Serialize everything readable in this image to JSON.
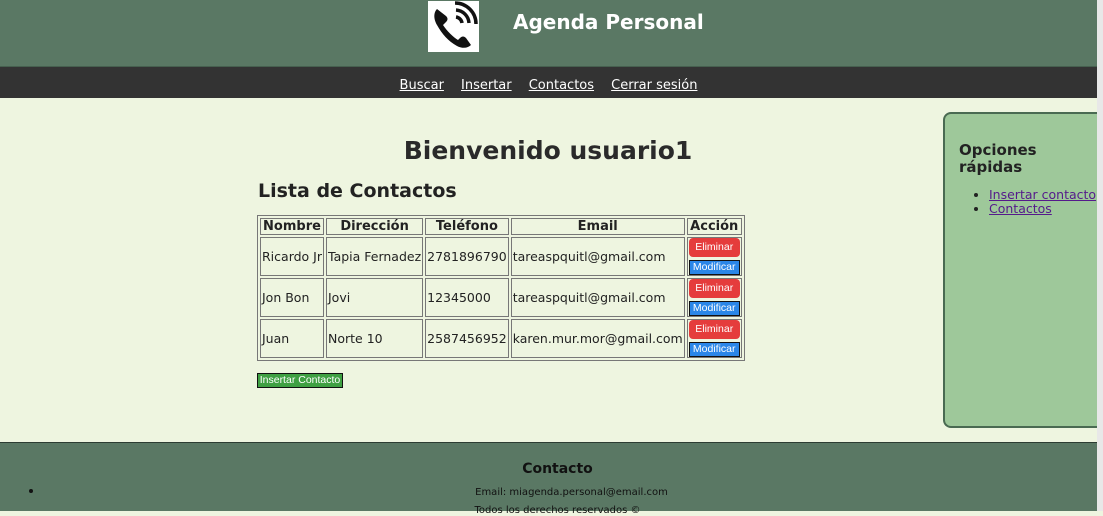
{
  "header": {
    "title": "Agenda Personal",
    "logo_icon": "phone-icon"
  },
  "nav": {
    "items": [
      "Buscar",
      "Insertar",
      "Contactos",
      "Cerrar sesión"
    ]
  },
  "main": {
    "welcome": "Bienvenido usuario1",
    "list_title": "Lista de Contactos",
    "table": {
      "headers": [
        "Nombre",
        "Dirección",
        "Teléfono",
        "Email",
        "Acción"
      ],
      "rows": [
        [
          "Ricardo Jr",
          "Tapia Fernadez",
          "2781896790",
          "tareaspquitl@gmail.com"
        ],
        [
          "Jon Bon",
          "Jovi",
          "12345000",
          "tareaspquitl@gmail.com"
        ],
        [
          "Juan",
          "Norte 10",
          "2587456952",
          "karen.mur.mor@gmail.com"
        ]
      ],
      "delete_label": "Eliminar",
      "modify_label": "Modificar"
    },
    "insert_button": "Insertar Contacto"
  },
  "aside": {
    "title": "Opciones rápidas",
    "links": [
      "Insertar contacto",
      "Contactos"
    ]
  },
  "footer": {
    "title": "Contacto",
    "email": "Email: miagenda.personal@email.com",
    "rights": "Todos los derechos reservados ©"
  },
  "colors": {
    "header_bg": "#5a7864",
    "nav_bg": "#333333",
    "page_bg": "#eef5e0",
    "aside_bg": "#9ec89a",
    "delete": "#e53c3c",
    "modify": "#2a86e8",
    "insert": "#3fa043"
  }
}
